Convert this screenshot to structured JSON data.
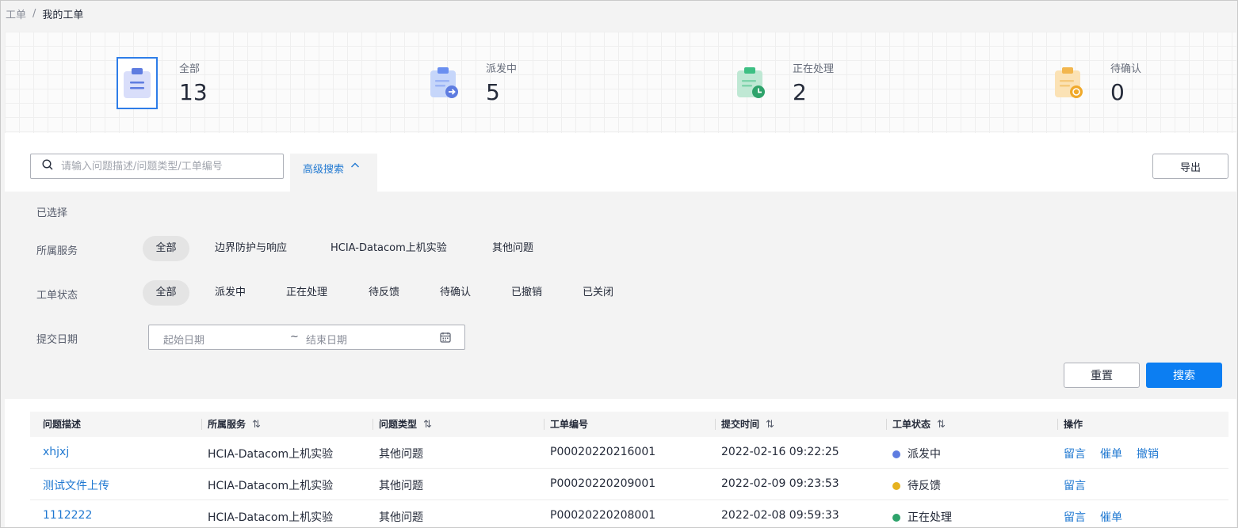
{
  "breadcrumb": {
    "root": "工单",
    "separator": "/",
    "current": "我的工单"
  },
  "stats": [
    {
      "label": "全部",
      "value": "13",
      "icon": "clipboard-list-icon",
      "active": true
    },
    {
      "label": "派发中",
      "value": "5",
      "icon": "clipboard-forward-icon"
    },
    {
      "label": "正在处理",
      "value": "2",
      "icon": "clipboard-clock-icon"
    },
    {
      "label": "待确认",
      "value": "0",
      "icon": "clipboard-confirm-icon"
    }
  ],
  "search": {
    "placeholder": "请输入问题描述/问题类型/工单编号",
    "advanced_label": "高级搜索",
    "export_label": "导出"
  },
  "filters": {
    "selected_label": "已选择",
    "service": {
      "label": "所属服务",
      "options": [
        "全部",
        "边界防护与响应",
        "HCIA-Datacom上机实验",
        "其他问题"
      ],
      "selected": "全部"
    },
    "status": {
      "label": "工单状态",
      "options": [
        "全部",
        "派发中",
        "正在处理",
        "待反馈",
        "待确认",
        "已撤销",
        "已关闭"
      ],
      "selected": "全部"
    },
    "date": {
      "label": "提交日期",
      "start_placeholder": "起始日期",
      "separator": "~",
      "end_placeholder": "结束日期"
    },
    "reset_label": "重置",
    "search_label": "搜索"
  },
  "table": {
    "columns": [
      {
        "label": "问题描述",
        "sortable": false
      },
      {
        "label": "所属服务",
        "sortable": true
      },
      {
        "label": "问题类型",
        "sortable": true
      },
      {
        "label": "工单编号",
        "sortable": false
      },
      {
        "label": "提交时间",
        "sortable": true
      },
      {
        "label": "工单状态",
        "sortable": true
      },
      {
        "label": "操作",
        "sortable": false
      }
    ],
    "sort_glyph": "⇅",
    "rows": [
      {
        "title": "xhjxj",
        "service": "HCIA-Datacom上机实验",
        "type": "其他问题",
        "id": "P00020220216001",
        "time": "2022-02-16 09:22:25",
        "status": "派发中",
        "status_color": "#5e7ce0",
        "actions": [
          "留言",
          "催单",
          "撤销"
        ]
      },
      {
        "title": "测试文件上传",
        "service": "HCIA-Datacom上机实验",
        "type": "其他问题",
        "id": "P00020220209001",
        "time": "2022-02-09 09:23:53",
        "status": "待反馈",
        "status_color": "#e6b21f",
        "actions": [
          "留言"
        ]
      },
      {
        "title": "1112222",
        "service": "HCIA-Datacom上机实验",
        "type": "其他问题",
        "id": "P00020220208001",
        "time": "2022-02-08 09:59:33",
        "status": "正在处理",
        "status_color": "#2ea36b",
        "actions": [
          "留言",
          "催单"
        ]
      }
    ]
  }
}
